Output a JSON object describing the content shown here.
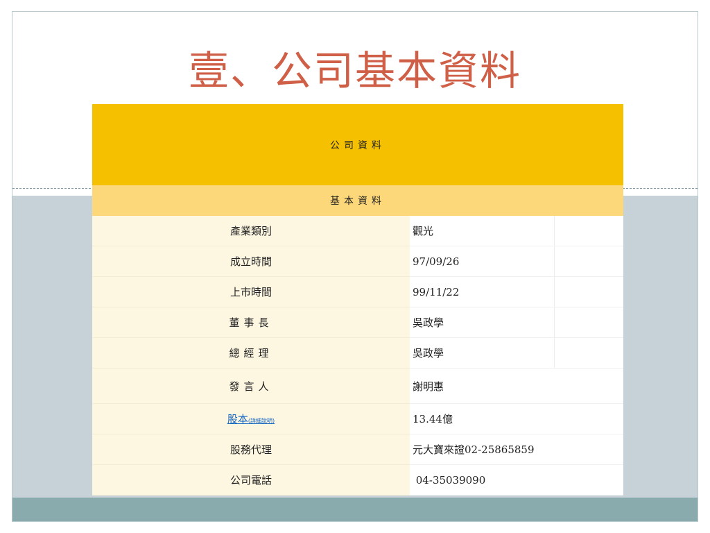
{
  "title": "壹、公司基本資料",
  "table": {
    "header_main": "公司資料",
    "header_sub": "基本資料",
    "rows": [
      {
        "label": "產業類別",
        "value": "觀光"
      },
      {
        "label": "成立時間",
        "value": "97/09/26"
      },
      {
        "label": "上市時間",
        "value": "99/11/22"
      },
      {
        "label": "董事長",
        "value": "吳政學"
      },
      {
        "label": "總經理",
        "value": "吳政學"
      },
      {
        "label": "發言人",
        "value": "謝明惠"
      },
      {
        "label": "股本",
        "label_note": "(詳細說明)",
        "value": "13.44億"
      },
      {
        "label": "股務代理",
        "value": "元大寶來證02-25865859"
      },
      {
        "label": "公司電話",
        "value": " 04-35039090"
      }
    ]
  },
  "colors": {
    "title": "#cf5f47",
    "header_main_bg": "#f5c000",
    "header_sub_bg": "#fdd87a",
    "label_bg": "#fdf7e2",
    "link": "#1565c0",
    "band_gray": "#c6d2d8",
    "band_teal": "#89abae"
  }
}
